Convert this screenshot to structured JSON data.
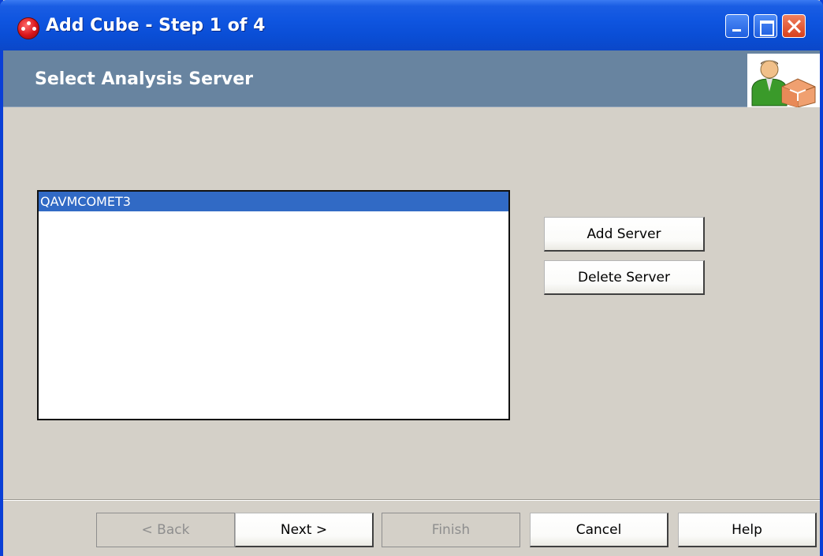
{
  "window": {
    "title": "Add Cube - Step 1 of 4",
    "app_icon": "red-app-icon"
  },
  "header": {
    "title": "Select Analysis Server",
    "icon": "user-with-cube-icon"
  },
  "server_list": {
    "items": [
      "QAVMCOMET3"
    ],
    "selected_index": 0
  },
  "side_buttons": {
    "add_label": "Add Server",
    "delete_label": "Delete Server"
  },
  "footer": {
    "back_label": "< Back",
    "next_label": "Next >",
    "finish_label": "Finish",
    "cancel_label": "Cancel",
    "help_label": "Help"
  },
  "colors": {
    "titlebar": "#0a4ed6",
    "header_band": "#6884a0",
    "selection": "#316ac5",
    "dialog_bg": "#d4d0c8"
  }
}
